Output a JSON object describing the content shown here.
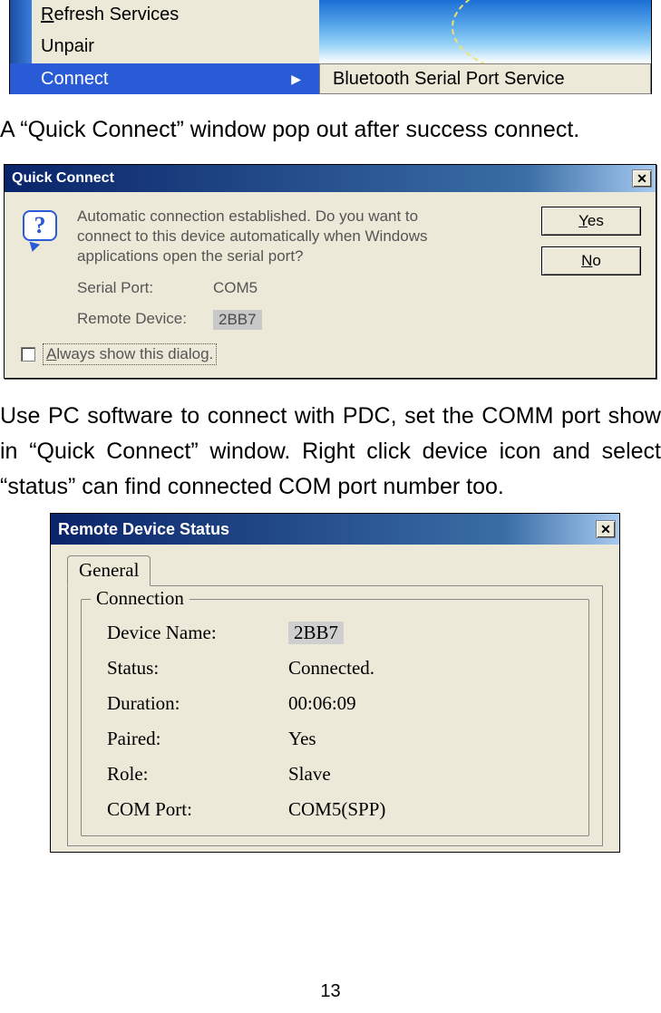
{
  "context_menu": {
    "items": [
      "Refresh Services",
      "Unpair",
      "Connect"
    ],
    "submenu": "Bluetooth Serial Port Service"
  },
  "para1": "A “Quick Connect” window pop out after success connect.",
  "quick_connect": {
    "title": "Quick Connect",
    "message": "Automatic connection established.  Do you want to connect to this device automatically when Windows applications open the serial port?",
    "serial_port_label": "Serial Port:",
    "serial_port_value": "COM5",
    "remote_device_label": "Remote Device:",
    "remote_device_value": "2BB7",
    "always_show": "Always show this dialog.",
    "yes": "Yes",
    "no": "No"
  },
  "para2": "Use PC software to connect with PDC, set the COMM port show in “Quick Connect” window. Right click device icon and select “status” can find connected COM port number too.",
  "remote_status": {
    "title": "Remote Device Status",
    "tab": "General",
    "legend": "Connection",
    "rows": {
      "device_name_label": "Device Name:",
      "device_name_value": "2BB7",
      "status_label": "Status:",
      "status_value": "Connected.",
      "duration_label": "Duration:",
      "duration_value": "00:06:09",
      "paired_label": "Paired:",
      "paired_value": "Yes",
      "role_label": "Role:",
      "role_value": "Slave",
      "com_port_label": "COM Port:",
      "com_port_value": "COM5(SPP)"
    }
  },
  "page_number": "13"
}
